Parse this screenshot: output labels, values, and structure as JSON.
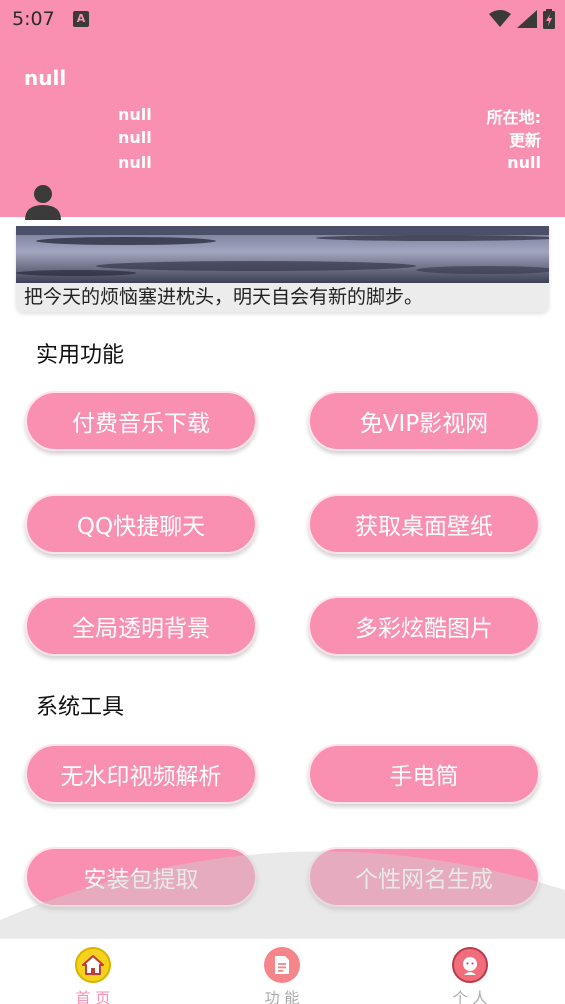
{
  "status_bar": {
    "time": "5:07",
    "notification_icon": "a-icon",
    "icons": [
      "wifi-icon",
      "signal-icon",
      "battery-icon"
    ]
  },
  "profile": {
    "name": "null",
    "left_fields": [
      "null",
      "null",
      "null"
    ],
    "location_label": "所在地:",
    "right_fields": [
      "更新",
      "null"
    ],
    "avatar_icon": "person-icon"
  },
  "banner": {
    "caption": "把今天的烦恼塞进枕头，明天自会有新的脚步。"
  },
  "sections": [
    {
      "title": "实用功能",
      "buttons": [
        "付费音乐下载",
        "免VIP影视网",
        "QQ快捷聊天",
        "获取桌面壁纸",
        "全局透明背景",
        "多彩炫酷图片"
      ]
    },
    {
      "title": "系统工具",
      "buttons": [
        "无水印视频解析",
        "手电筒",
        "安装包提取",
        "个性网名生成"
      ]
    }
  ],
  "bottom_nav": [
    {
      "label": "首 页",
      "icon": "home-icon",
      "active": true
    },
    {
      "label": "功 能",
      "icon": "document-icon",
      "active": false
    },
    {
      "label": "个 人",
      "icon": "user-icon",
      "active": false
    }
  ],
  "colors": {
    "accent": "#f98fb1",
    "nav_home": "#f5d21c",
    "nav_func": "#f4858a",
    "nav_user": "#f16d7c"
  }
}
